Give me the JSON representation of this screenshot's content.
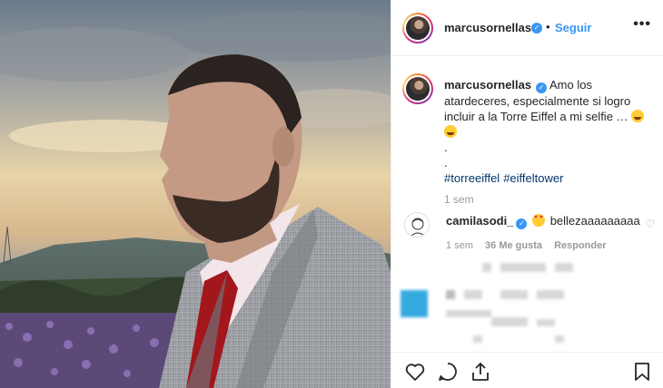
{
  "post": {
    "username": "marcusornellas",
    "separator": "•",
    "follow_label": "Seguir",
    "more_label": "•••"
  },
  "caption": {
    "username": "marcusornellas",
    "text": "Amo los atardeceres, especialmente si logro incluir a la Torre Eiffel a mi selfie …",
    "dots": [
      ".",
      "."
    ],
    "hashtags": [
      "#torreeiffel",
      "#eiffeltower"
    ],
    "time": "1 sem"
  },
  "comment": {
    "username": "camilasodi_",
    "text": "bellezaaaaaaaaa",
    "time": "1 sem",
    "likes": "36 Me gusta",
    "reply_label": "Responder"
  },
  "icons": {
    "like": "heart-icon",
    "comment": "comment-icon",
    "share": "share-icon",
    "save": "bookmark-icon",
    "verified": "verified-badge-icon"
  },
  "colors": {
    "accent_link": "#3897f0",
    "hashtag": "#003569",
    "verified": "#3897f0",
    "muted": "#999999"
  }
}
